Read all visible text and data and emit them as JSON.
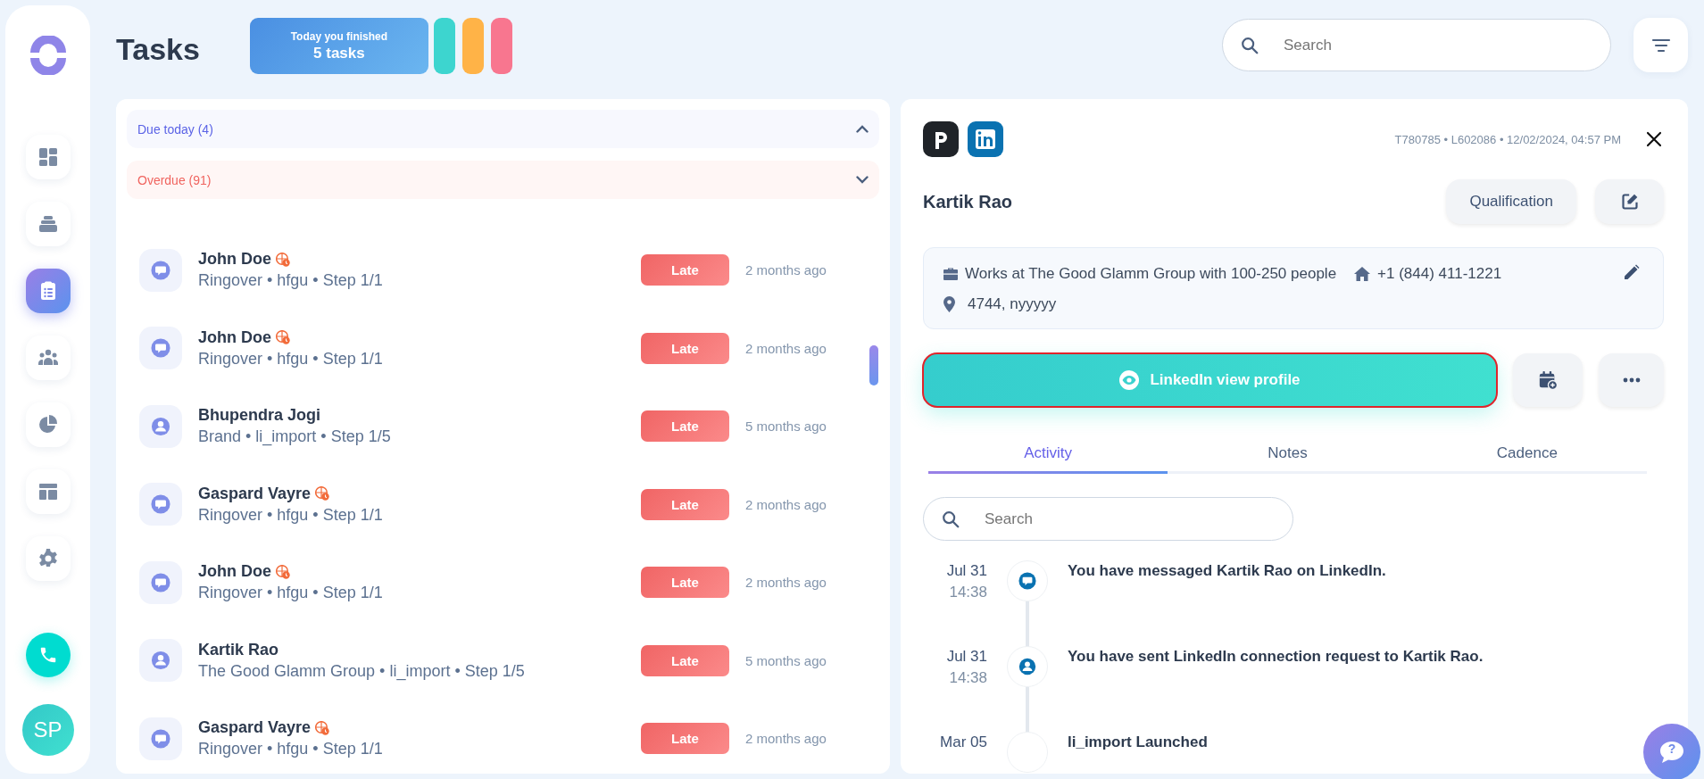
{
  "sidebar": {
    "items": [
      {
        "kind": "dashboard",
        "selected": false
      },
      {
        "kind": "stack",
        "selected": false
      },
      {
        "kind": "tasks",
        "selected": true
      },
      {
        "kind": "people",
        "selected": false
      },
      {
        "kind": "chart",
        "selected": false
      },
      {
        "kind": "layout",
        "selected": false
      },
      {
        "kind": "settings",
        "selected": false
      }
    ],
    "avatar": "SP"
  },
  "header": {
    "title": "Tasks",
    "stats": {
      "caption": "Today you finished",
      "value": "5 tasks"
    },
    "color_pills": [
      {
        "color": "#3dd5cf"
      },
      {
        "color": "#ffb347"
      },
      {
        "color": "#f8768f"
      }
    ],
    "search": {
      "placeholder": "Search"
    }
  },
  "task_list": {
    "sections": [
      {
        "label": "Due today (4)",
        "expanded": true,
        "color": "#5b63e6"
      },
      {
        "label": "Overdue (91)",
        "expanded": false,
        "color": "#f0645f"
      }
    ],
    "rows": [
      {
        "kind": "message",
        "name": "John Doe",
        "timezone_badge": true,
        "subtitle": "Ringover • hfgu • Step 1/1",
        "status": "Late",
        "time": "2 months ago"
      },
      {
        "kind": "message",
        "name": "John Doe",
        "timezone_badge": true,
        "subtitle": "Ringover • hfgu • Step 1/1",
        "status": "Late",
        "time": "2 months ago"
      },
      {
        "kind": "person",
        "name": "Bhupendra Jogi",
        "timezone_badge": false,
        "subtitle": "Brand • li_import • Step 1/5",
        "status": "Late",
        "time": "5 months ago"
      },
      {
        "kind": "message",
        "name": "Gaspard Vayre",
        "timezone_badge": true,
        "subtitle": "Ringover • hfgu • Step 1/1",
        "status": "Late",
        "time": "2 months ago"
      },
      {
        "kind": "message",
        "name": "John Doe",
        "timezone_badge": true,
        "subtitle": "Ringover • hfgu • Step 1/1",
        "status": "Late",
        "time": "2 months ago"
      },
      {
        "kind": "person",
        "name": "Kartik Rao",
        "timezone_badge": false,
        "subtitle": "The Good Glamm Group • li_import • Step 1/5",
        "status": "Late",
        "time": "5 months ago"
      },
      {
        "kind": "message",
        "name": "Gaspard Vayre",
        "timezone_badge": true,
        "subtitle": "Ringover • hfgu • Step 1/1",
        "status": "Late",
        "time": "2 months ago"
      }
    ]
  },
  "detail": {
    "meta": "T780785 • L602086 • 12/02/2024, 04:57 PM",
    "name": "Kartik Rao",
    "qualification_button": "Qualification",
    "info": {
      "company": "Works at The Good Glamm Group with 100-250 people",
      "phone": "+1 (844) 411-1221",
      "address": "4744, nyyyyy"
    },
    "primary_action": {
      "label": "LinkedIn view profile",
      "focused": true
    },
    "tabs": [
      {
        "label": "Activity",
        "selected": true
      },
      {
        "label": "Notes",
        "selected": false
      },
      {
        "label": "Cadence",
        "selected": false
      }
    ],
    "activity_search": {
      "placeholder": "Search"
    },
    "timeline": [
      {
        "kind": "message",
        "date": "Jul 31",
        "time": "14:38",
        "text": "You have messaged Kartik Rao on LinkedIn."
      },
      {
        "kind": "person",
        "date": "Jul 31",
        "time": "14:38",
        "text": "You have sent LinkedIn connection request to Kartik Rao."
      },
      {
        "kind": "launch",
        "date": "Mar 05",
        "text": "li_import Launched"
      }
    ]
  },
  "help_button": {
    "label": "?"
  }
}
